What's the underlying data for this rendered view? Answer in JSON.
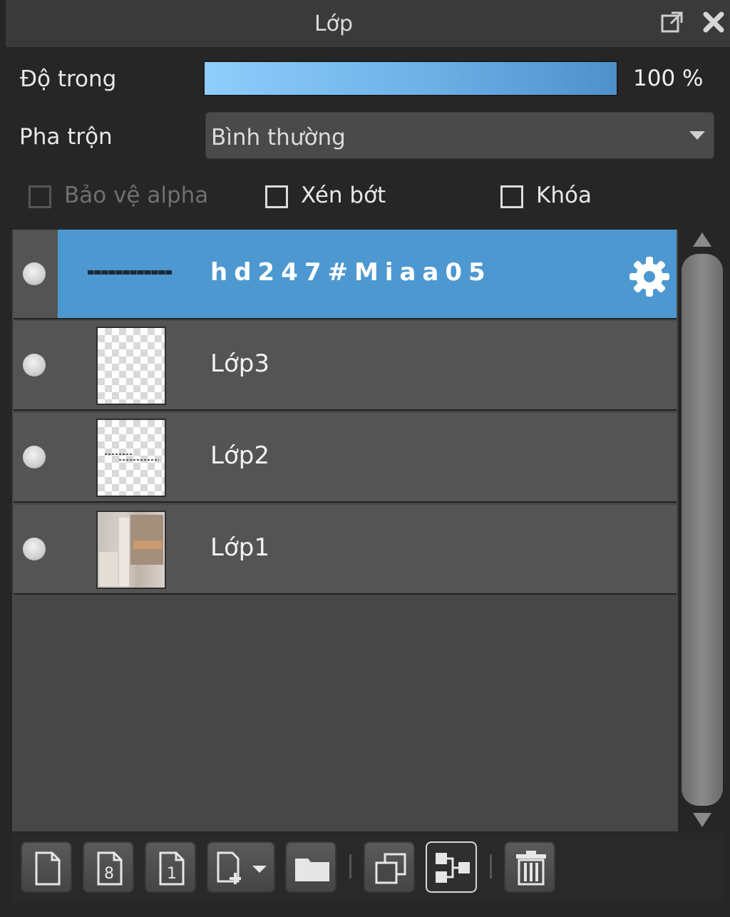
{
  "panel": {
    "title": "Lớp",
    "undock_icon": "undock-icon",
    "close_icon": "close-icon"
  },
  "opacity": {
    "label": "Độ trong",
    "value": "100 %",
    "fraction": 1.0,
    "gradient_start": "#8fcdfc",
    "gradient_end": "#4f90ca"
  },
  "blend": {
    "label": "Pha trộn",
    "selected": "Bình thường"
  },
  "options": {
    "protect_alpha": {
      "label": "Bảo vệ alpha",
      "checked": false,
      "enabled": false
    },
    "clipping": {
      "label": "Xén bớt",
      "checked": false,
      "enabled": true
    },
    "lock": {
      "label": "Khóa",
      "checked": false,
      "enabled": true
    }
  },
  "layers": [
    {
      "name": "hd247#Miaa05",
      "type": "text",
      "selected": true,
      "visible": true
    },
    {
      "name": "Lớp3",
      "type": "raster",
      "selected": false,
      "visible": true
    },
    {
      "name": "Lớp2",
      "type": "raster",
      "selected": false,
      "visible": true
    },
    {
      "name": "Lớp1",
      "type": "raster",
      "selected": false,
      "visible": true
    }
  ],
  "colors": {
    "selected_row": "#4d98d0",
    "row": "#545454",
    "list_bg": "#474747"
  },
  "toolbar": {
    "buttons": [
      "new-layer-icon",
      "new-8bit-layer-icon",
      "new-1bit-layer-icon",
      "add-layer-menu-icon",
      "new-folder-icon",
      "duplicate-layer-icon",
      "merge-down-icon",
      "delete-layer-icon"
    ]
  }
}
